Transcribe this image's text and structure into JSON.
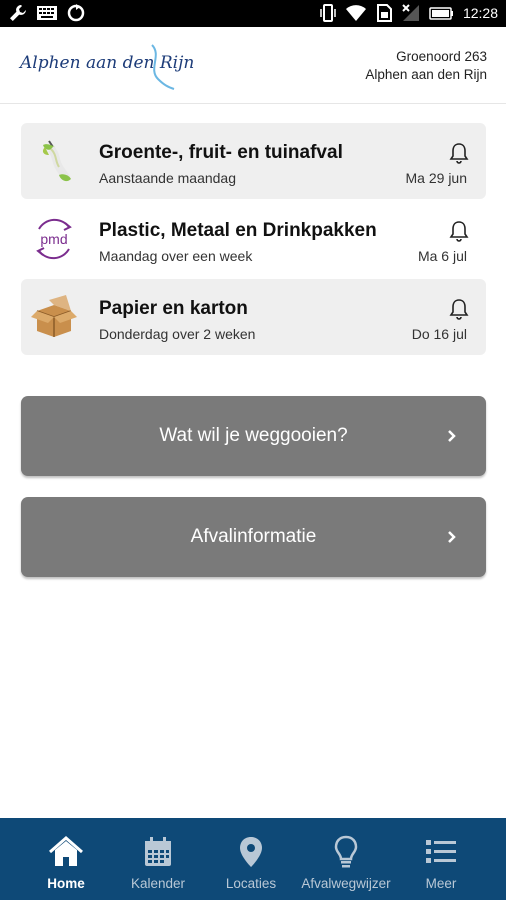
{
  "status_bar": {
    "time": "12:28"
  },
  "header": {
    "logo_text": "Alphen aan den Rijn",
    "address_line1": "Groenoord 263",
    "address_line2": "Alphen aan den Rijn"
  },
  "collections": [
    {
      "title": "Groente-, fruit- en tuinafval",
      "subtitle": "Aanstaande maandag",
      "date": "Ma 29 jun",
      "icon": "apple-core-icon"
    },
    {
      "title": "Plastic, Metaal en Drinkpakken",
      "subtitle": "Maandag over een week",
      "date": "Ma 6 jul",
      "icon": "pmd-icon"
    },
    {
      "title": "Papier en karton",
      "subtitle": "Donderdag over 2 weken",
      "date": "Do 16 jul",
      "icon": "cardboard-box-icon"
    }
  ],
  "actions": {
    "waste_search": "Wat wil je weggooien?",
    "waste_info": "Afvalinformatie"
  },
  "nav": [
    {
      "label": "Home",
      "icon": "home-icon",
      "active": true
    },
    {
      "label": "Kalender",
      "icon": "calendar-icon",
      "active": false
    },
    {
      "label": "Locaties",
      "icon": "location-pin-icon",
      "active": false
    },
    {
      "label": "Afvalwegwijzer",
      "icon": "lightbulb-icon",
      "active": false
    },
    {
      "label": "Meer",
      "icon": "list-icon",
      "active": false
    }
  ],
  "colors": {
    "brand_navy": "#0e4977",
    "button_gray": "#7a7a7a",
    "card_gray": "#efefef",
    "logo_blue": "#1d3c79"
  }
}
